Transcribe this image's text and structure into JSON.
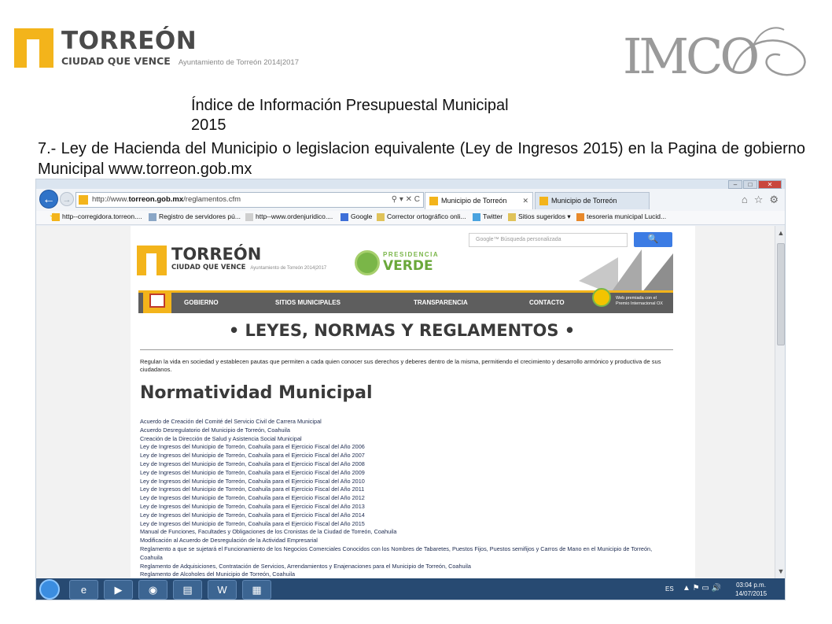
{
  "slide": {
    "logo_word": "TORREÓN",
    "logo_slogan": "CIUDAD QUE VENCE",
    "logo_ayuntamiento": "Ayuntamiento de Torreón 2014|2017",
    "imco_text": "IMCO",
    "title_line1": "Índice de Información Presupuestal Municipal",
    "title_line2": "2015",
    "description": "7.- Ley de Hacienda del Municipio  o legislacion equivalente (Ley de Ingresos 2015) en la Pagina de gobierno Municipal www.torreon.gob.mx"
  },
  "browser": {
    "url_prefix": "http://www.",
    "url_domain": "torreon.gob.mx",
    "url_path": "/reglamentos.cfm",
    "address_controls": "⚲ ▾ ✕ C",
    "tabs": [
      {
        "label": "Municipio de Torreón",
        "active": true
      },
      {
        "label": "Municipio de Torreón",
        "active": false
      }
    ],
    "favorites": [
      "http--corregidora.torreon....",
      "Registro de servidores pú...",
      "http--www.ordenjuridico....",
      "Google",
      "Corrector ortográfico onli...",
      "Twitter",
      "Sitios sugeridos ▾",
      "tesoreria municipal Lucid..."
    ]
  },
  "site": {
    "search_placeholder": "Google™ Búsqueda personalizada",
    "search_icon": "🔍",
    "logo_word": "TORREÓN",
    "logo_slogan": "CIUDAD QUE VENCE",
    "logo_ayuntamiento": "Ayuntamiento de Torreón 2014|2017",
    "verde_small": "PRESIDENCIA",
    "verde_big": "VERDE",
    "award_text_1": "Web premiada con el",
    "award_text_2": "Premio Internacional OX",
    "nav": [
      "GOBIERNO",
      "SITIOS MUNICIPALES",
      "TRANSPARENCIA",
      "CONTACTO"
    ],
    "heading": "• LEYES, NORMAS Y REGLAMENTOS •",
    "intro": "Regulan la vida en sociedad y establecen pautas que permiten a cada quien conocer sus derechos y deberes dentro de la misma, permitiendo el crecimiento y desarrollo armónico y productiva de sus ciudadanos.",
    "norm_title": "Normatividad Municipal",
    "documents": [
      "Acuerdo de Creación del Comité del Servicio Civil de Carrera Municipal",
      "Acuerdo Desregulatorio del Municipio de Torreón, Coahuila",
      "Creación de la Dirección de Salud y Asistencia Social Municipal",
      "Ley de Ingresos del Municipio de Torreón, Coahuila para el Ejercicio Fiscal del Año 2006",
      "Ley de Ingresos del Municipio de Torreón, Coahuila para el Ejercicio Fiscal del Año 2007",
      "Ley de Ingresos del Municipio de Torreón, Coahuila para el Ejercicio Fiscal del Año 2008",
      "Ley de Ingresos del Municipio de Torreón, Coahuila para el Ejercicio Fiscal del Año 2009",
      "Ley de Ingresos del Municipio de Torreón, Coahuila para el Ejercicio Fiscal del Año 2010",
      "Ley de Ingresos del Municipio de Torreón, Coahuila para el Ejercicio Fiscal del Año 2011",
      "Ley de Ingresos del Municipio de Torreón, Coahuila para el Ejercicio Fiscal del Año 2012",
      "Ley de Ingresos del Municipio de Torreón, Coahuila para el Ejercicio Fiscal del Año 2013",
      "Ley de Ingresos del Municipio de Torreón, Coahuila para el Ejercicio Fiscal del Año 2014",
      "Ley de Ingresos del Municipio de Torreón, Coahuila para el Ejercicio Fiscal del Año 2015",
      "Manual de Funciones, Facultades y Obligaciones de los Cronistas de la Ciudad de Torreón, Coahuila",
      "Modificación al Acuerdo de Desregulación de la Actividad Empresarial",
      "Reglamento a que se sujetará el Funcionamiento de los Negocios Comerciales Conocidos con los Nombres de Tabaretes, Puestos Fijos, Puestos semifijos y Carros de Mano en el Municipio de Torreón, Coahuila",
      "Reglamento de Adquisiciones, Contratación de Servicios, Arrendamientos y Enajenaciones para el Municipio de Torreón, Coahuila",
      "Reglamento de Alcoholes del Municipio de Torreón, Coahuila"
    ]
  },
  "taskbar": {
    "lang": "ES",
    "tray_icons": "▲ ⚑ ▭ 🔊",
    "time": "03:04 p.m.",
    "date": "14/07/2015"
  },
  "colors": {
    "torreon_yellow": "#f3b41b",
    "verde": "#7ab648",
    "nav_gray": "#5e5e5e",
    "search_blue": "#3c7ce4",
    "taskbar": "#274a72"
  }
}
